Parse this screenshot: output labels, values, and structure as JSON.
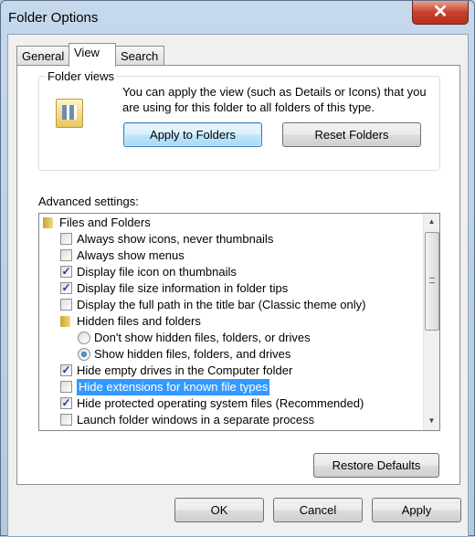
{
  "window": {
    "title": "Folder Options",
    "close_glyph": "✕"
  },
  "tabs": [
    {
      "label": "General"
    },
    {
      "label": "View",
      "active": true
    },
    {
      "label": "Search"
    }
  ],
  "folder_views": {
    "label": "Folder views",
    "description": "You can apply the view (such as Details or Icons) that you are using for this folder to all folders of this type.",
    "apply_label": "Apply to Folders",
    "reset_label": "Reset Folders"
  },
  "advanced": {
    "label": "Advanced settings:",
    "items": [
      {
        "type": "folder",
        "label": "Files and Folders",
        "indent": 0
      },
      {
        "type": "checkbox",
        "label": "Always show icons, never thumbnails",
        "checked": false,
        "indent": 1
      },
      {
        "type": "checkbox",
        "label": "Always show menus",
        "checked": false,
        "indent": 1
      },
      {
        "type": "checkbox",
        "label": "Display file icon on thumbnails",
        "checked": true,
        "indent": 1
      },
      {
        "type": "checkbox",
        "label": "Display file size information in folder tips",
        "checked": true,
        "indent": 1
      },
      {
        "type": "checkbox",
        "label": "Display the full path in the title bar (Classic theme only)",
        "checked": false,
        "indent": 1
      },
      {
        "type": "folder",
        "label": "Hidden files and folders",
        "indent": 1
      },
      {
        "type": "radio",
        "label": "Don't show hidden files, folders, or drives",
        "checked": false,
        "indent": 2
      },
      {
        "type": "radio",
        "label": "Show hidden files, folders, and drives",
        "checked": true,
        "indent": 2
      },
      {
        "type": "checkbox",
        "label": "Hide empty drives in the Computer folder",
        "checked": true,
        "indent": 1
      },
      {
        "type": "checkbox",
        "label": "Hide extensions for known file types",
        "checked": false,
        "indent": 1,
        "selected": true
      },
      {
        "type": "checkbox",
        "label": "Hide protected operating system files (Recommended)",
        "checked": true,
        "indent": 1
      },
      {
        "type": "checkbox",
        "label": "Launch folder windows in a separate process",
        "checked": false,
        "indent": 1
      }
    ]
  },
  "restore_label": "Restore Defaults",
  "footer": {
    "ok": "OK",
    "cancel": "Cancel",
    "apply": "Apply"
  },
  "colors": {
    "selection": "#3399ff",
    "close": "#c8402c"
  }
}
